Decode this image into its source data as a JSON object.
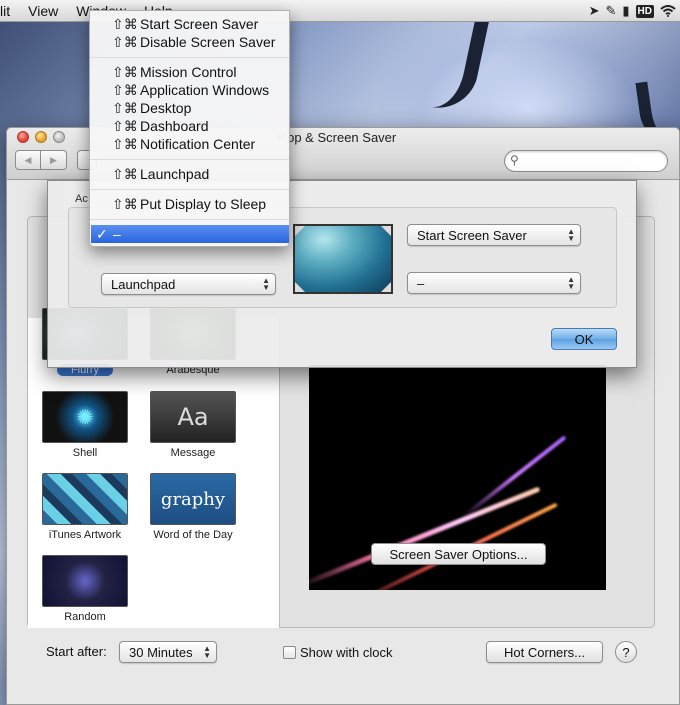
{
  "menubar": {
    "items": [
      "lit",
      "View",
      "Window",
      "Help"
    ],
    "hd_badge": "HD"
  },
  "window": {
    "title": "ktop & Screen Saver"
  },
  "screen_savers": [
    {
      "name": "Flurry",
      "selected": true
    },
    {
      "name": "Arabesque",
      "selected": false
    },
    {
      "name": "Shell",
      "selected": false
    },
    {
      "name": "Message",
      "selected": false,
      "thumb_text": "Aa"
    },
    {
      "name": "iTunes Artwork",
      "selected": false
    },
    {
      "name": "Word of the Day",
      "selected": false,
      "thumb_text": "graphy"
    },
    {
      "name": "Random",
      "selected": false
    }
  ],
  "buttons": {
    "screen_saver_options": "Screen Saver Options...",
    "hot_corners": "Hot Corners...",
    "help": "?",
    "ok": "OK"
  },
  "start_after": {
    "label": "Start after:",
    "value": "30 Minutes"
  },
  "show_with_clock": {
    "label": "Show with clock",
    "checked": false
  },
  "hot_corners_sheet": {
    "label": "Ac",
    "top_left": "–",
    "bottom_left": "Launchpad",
    "top_right": "Start Screen Saver",
    "bottom_right": "–"
  },
  "dropdown_menu": {
    "shortcut_prefix": "⇧⌘",
    "groups": [
      [
        "Start Screen Saver",
        "Disable Screen Saver"
      ],
      [
        "Mission Control",
        "Application Windows",
        "Desktop",
        "Dashboard",
        "Notification Center"
      ],
      [
        "Launchpad"
      ],
      [
        "Put Display to Sleep"
      ]
    ],
    "selected_item": "–",
    "check_mark": "✓"
  },
  "colors": {
    "selection_blue": "#3a77d6",
    "menu_highlight": "#2a64e0",
    "default_button": "#6eaee8"
  }
}
